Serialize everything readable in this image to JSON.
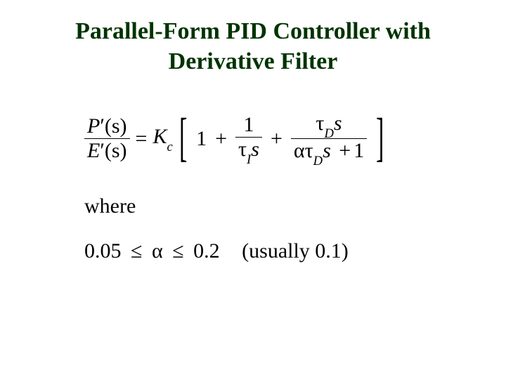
{
  "title_line1": "Parallel-Form PID Controller with",
  "title_line2": "Derivative Filter",
  "eq": {
    "lhs_num_P": "P",
    "lhs_num_prime": "′",
    "lhs_num_s": "(s)",
    "lhs_den_E": "E",
    "lhs_den_prime": "′",
    "lhs_den_s": "(s)",
    "equals": "=",
    "Kc_K": "K",
    "Kc_sub": "c",
    "one": "1",
    "plus1": "+",
    "mid_num": "1",
    "tau": "τ",
    "I_sub": "I",
    "s": "s",
    "plus2": "+",
    "D_sub": "D",
    "alpha": "α",
    "plus3": "+",
    "one2": "1"
  },
  "where": "where",
  "range": {
    "low": "0.05",
    "le1": "≤",
    "alpha": "α",
    "le2": "≤",
    "high": "0.2",
    "note": "(usually 0.1)"
  },
  "chart_data": {
    "type": "table",
    "title": "Parallel-Form PID Controller with Derivative Filter",
    "equation_text": "P'(s)/E'(s) = Kc [ 1 + 1/(τI s) + (τD s)/(α τD s + 1) ]",
    "alpha_range": {
      "min": 0.05,
      "max": 0.2,
      "typical": 0.1
    }
  }
}
